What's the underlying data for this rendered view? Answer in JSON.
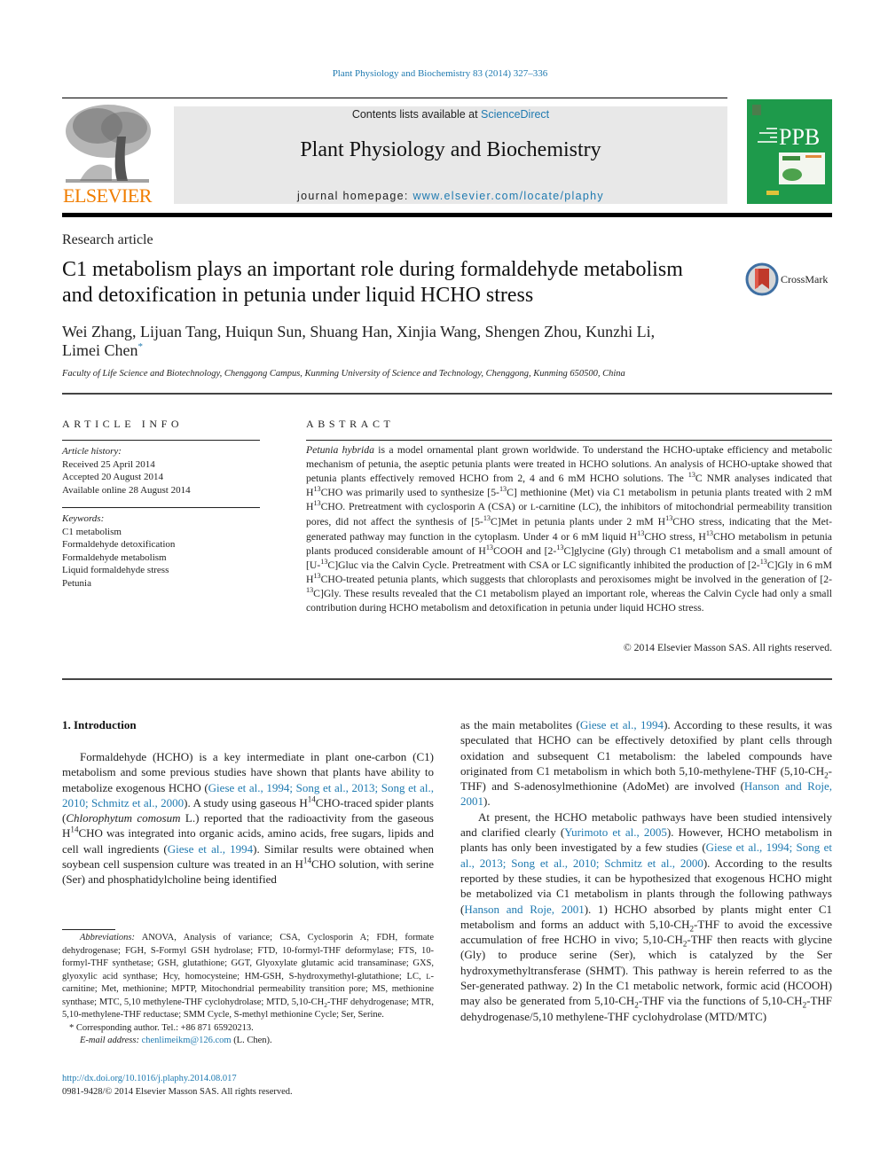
{
  "running_head": "Plant Physiology and Biochemistry 83 (2014) 327–336",
  "header": {
    "publisher_logo_text": "ELSEVIER",
    "contents_prefix": "Contents lists available at ",
    "contents_link": "ScienceDirect",
    "journal_title": "Plant Physiology and Biochemistry",
    "homepage_prefix": "journal homepage: ",
    "homepage_link": "www.elsevier.com/locate/plaphy",
    "cover_acronym": "PPB"
  },
  "colors": {
    "link": "#1f7ab0",
    "elsevier_orange": "#f07d00",
    "cover_green": "#1e9a4b",
    "masthead_gray": "#e8e8e8"
  },
  "article": {
    "type": "Research article",
    "title": "C1 metabolism plays an important role during formaldehyde metabolism and detoxification in petunia under liquid HCHO stress",
    "crossmark_label": "CrossMark",
    "authors_line1": "Wei Zhang, Lijuan Tang, Huiqun Sun, Shuang Han, Xinjia Wang, Shengen Zhou, Kunzhi Li,",
    "authors_line2": "Limei Chen",
    "corresponding_mark": "*",
    "affiliation": "Faculty of Life Science and Biotechnology, Chenggong Campus, Kunming University of Science and Technology, Chenggong, Kunming 650500, China"
  },
  "article_info": {
    "heading": "ARTICLE INFO",
    "history_label": "Article history:",
    "history": [
      "Received 25 April 2014",
      "Accepted 20 August 2014",
      "Available online 28 August 2014"
    ],
    "keywords_label": "Keywords:",
    "keywords": [
      "C1 metabolism",
      "Formaldehyde detoxification",
      "Formaldehyde metabolism",
      "Liquid formaldehyde stress",
      "Petunia"
    ]
  },
  "abstract": {
    "heading": "ABSTRACT",
    "species": "Petunia hybrida",
    "s1": " is a model ornamental plant grown worldwide. To understand the HCHO-uptake efficiency and metabolic mechanism of petunia, the aseptic petunia plants were treated in HCHO solutions. An analysis of HCHO-uptake showed that petunia plants effectively removed HCHO from 2, 4 and 6 mM HCHO solutions. The ",
    "s2": "C NMR analyses indicated that H",
    "s3": "CHO was primarily used to synthesize [5-",
    "s4": "C] methionine (Met) via C1 metabolism in petunia plants treated with 2 mM H",
    "s5": "CHO. Pretreatment with cyclosporin A (CSA) or ",
    "l_prefix": "L",
    "s6": "-carnitine (LC), the inhibitors of mitochondrial permeability transition pores, did not affect the synthesis of [5-",
    "s7": "C]Met in petunia plants under 2 mM H",
    "s8": "CHO stress, indicating that the Met-generated pathway may function in the cytoplasm. Under 4 or 6 mM liquid H",
    "s9": "CHO stress, H",
    "s10": "CHO metabolism in petunia plants produced considerable amount of H",
    "s11": "COOH and [2-",
    "s12": "C]glycine (Gly) through C1 metabolism and a small amount of [U-",
    "s13": "C]Gluc via the Calvin Cycle. Pretreatment with CSA or LC significantly inhibited the production of [2-",
    "s14": "C]Gly in 6 mM H",
    "s15": "CHO-treated petunia plants, which suggests that chloroplasts and peroxisomes might be involved in the generation of [2-",
    "s16": "C]Gly. These results revealed that the C1 metabolism played an important role, whereas the Calvin Cycle had only a small contribution during HCHO metabolism and detoxification in petunia under liquid HCHO stress.",
    "isotope13": "13",
    "copyright": "© 2014 Elsevier Masson SAS. All rights reserved."
  },
  "intro": {
    "heading": "1.  Introduction",
    "l1": "Formaldehyde (HCHO) is a key intermediate in plant one-carbon (C1) metabolism and some previous studies have shown that plants have ability to metabolize exogenous HCHO (",
    "c1": "Giese et al., 1994; Song et al., 2013; Song et al., 2010; Schmitz et al., 2000",
    "l2": "). A study using gaseous H",
    "iso14": "14",
    "l3": "CHO-traced spider plants (",
    "species": "Chlorophytum comosum",
    "l4": " L.) reported that the radioactivity from the gaseous H",
    "l5": "CHO was integrated into organic acids, amino acids, free sugars, lipids and cell wall ingredients (",
    "c2": "Giese et al., 1994",
    "l6": "). Similar results were obtained when soybean cell suspension culture was treated in an H",
    "l7": "CHO solution, with serine (Ser) and phosphatidylcholine being identified",
    "r1": "as the main metabolites (",
    "c3": "Giese et al., 1994",
    "r2": "). According to these results, it was speculated that HCHO can be effectively detoxified by plant cells through oxidation and subsequent C1 metabolism: the labeled compounds have originated from C1 metabolism in which both 5,10-methylene-THF (5,10-CH",
    "sub2": "2",
    "r3": "-THF) and S-adenosylmethionine (AdoMet) are involved (",
    "c4": "Hanson and Roje, 2001",
    "r4": ").",
    "r5": "At present, the HCHO metabolic pathways have been studied intensively and clarified clearly (",
    "c5": "Yurimoto et al., 2005",
    "r6": "). However, HCHO metabolism in plants has only been investigated by a few studies (",
    "c6": "Giese et al., 1994; Song et al., 2013; Song et al., 2010; Schmitz et al., 2000",
    "r7": "). According to the results reported by these studies, it can be hypothesized that exogenous HCHO might be metabolized via C1 metabolism in plants through the following pathways (",
    "c7": "Hanson and Roje, 2001",
    "r8": "). 1) HCHO absorbed by plants might enter C1 metabolism and forms an adduct with 5,10-CH",
    "r9": "-THF to avoid the excessive accumulation of free HCHO in vivo; 5,10-CH",
    "r10": "-THF then reacts with glycine (Gly) to produce serine (Ser), which is catalyzed by the Ser hydroxymethyltransferase (SHMT). This pathway is herein referred to as the Ser-generated pathway. 2) In the C1 metabolic network, formic acid (HCOOH) may also be generated from 5,10-CH",
    "r11": "-THF via the functions of 5,10-CH",
    "r12": "-THF dehydrogenase/5,10 methylene-THF cyclohydrolase (MTD/MTC)"
  },
  "footnotes": {
    "abbr_label": "Abbreviations:",
    "abbr_1": " ANOVA, Analysis of variance; CSA, Cyclosporin A; FDH, formate dehydrogenase; FGH, S-Formyl GSH hydrolase; FTD, 10-formyl-THF deformylase; FTS, 10-formyl-THF synthetase; GSH, glutathione; GGT, Glyoxylate glutamic acid transaminase; GXS, glyoxylic acid synthase; Hcy, homocysteine; HM-GSH, S-hydroxymethyl-glutathione; LC, ",
    "abbr_l": "L",
    "abbr_2": "-carnitine; Met, methionine; MPTP, Mitochondrial permeability transition pore; MS, methionine synthase; MTC, 5,10 methylene-THF cyclohydrolase; MTD, 5,10-CH",
    "abbr_sub": "2",
    "abbr_3": "-THF dehydrogenase; MTR, 5,10-methylene-THF reductase; SMM Cycle, S-methyl methionine Cycle; Ser, Serine.",
    "corresponding": "* Corresponding author. Tel.: +86 871 65920213.",
    "email_label": "E-mail address:",
    "email": "chenlimeikm@126.com",
    "email_suffix": " (L. Chen)."
  },
  "footer": {
    "doi": "http://dx.doi.org/10.1016/j.plaphy.2014.08.017",
    "issn": "0981-9428/© 2014 Elsevier Masson SAS. All rights reserved."
  }
}
